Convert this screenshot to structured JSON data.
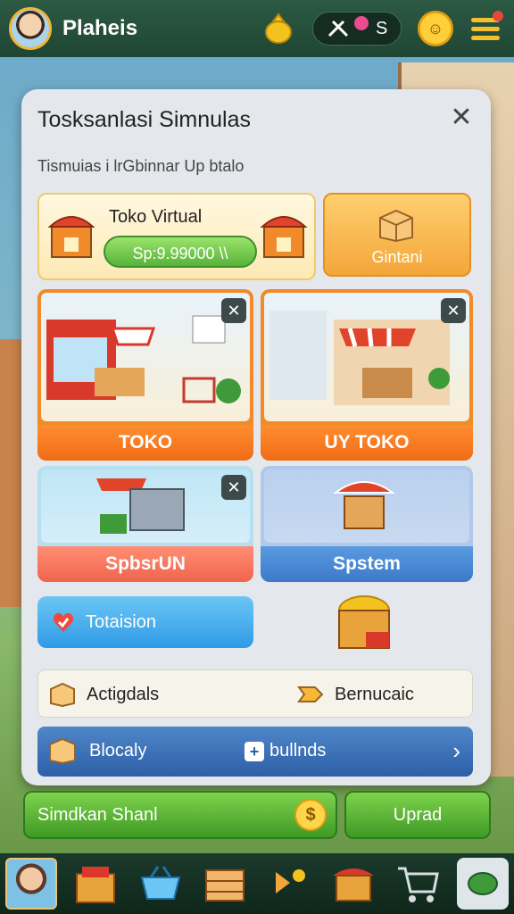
{
  "top_bar": {
    "player_name": "Plaheis",
    "currency_label": "S",
    "notification_count": "",
    "gold_icon": "gold-coin-icon"
  },
  "panel": {
    "title": "Tosksanlasi Simnulas",
    "close_label": "✕",
    "subtitle": "Tismuias i lrGbinnar Up btalo",
    "toko_virtual": {
      "label": "Toko Virtual",
      "price": "Sp:9.99000 \\\\"
    },
    "gintani_label": "Gintani",
    "shop_cards": [
      {
        "label": "TOKO",
        "badge": "✕"
      },
      {
        "label": "UY TOKO",
        "badge": "✕"
      },
      {
        "label": "SpbsrUN",
        "badge": "✕"
      },
      {
        "label": "Spstem",
        "badge": ""
      }
    ],
    "tutorial_label": "Totaision",
    "actions": {
      "left_label": "Actigdals",
      "right_label": "Bernucaic"
    },
    "bulk_row": {
      "left_label": "Blocaly",
      "right_label": "bullnds",
      "chevron": "›"
    }
  },
  "bottom_buttons": {
    "save_label": "Simdkan Shanl",
    "save_coin": "$",
    "upgrade_label": "Uprad"
  },
  "dock": [
    {
      "icon": "profile-avatar-icon"
    },
    {
      "icon": "shop-crate-icon"
    },
    {
      "icon": "shopping-basket-icon"
    },
    {
      "icon": "wooden-crate-icon"
    },
    {
      "icon": "sparkle-arrow-icon"
    },
    {
      "icon": "market-stall-icon"
    },
    {
      "icon": "shopping-cart-icon"
    },
    {
      "icon": "settings-gem-icon"
    }
  ],
  "colors": {
    "top_bar": "#2c5a43",
    "panel": "#e4e8ec",
    "orange": "#f06b17",
    "green": "#3f9a25",
    "blue": "#2d5fa6"
  }
}
